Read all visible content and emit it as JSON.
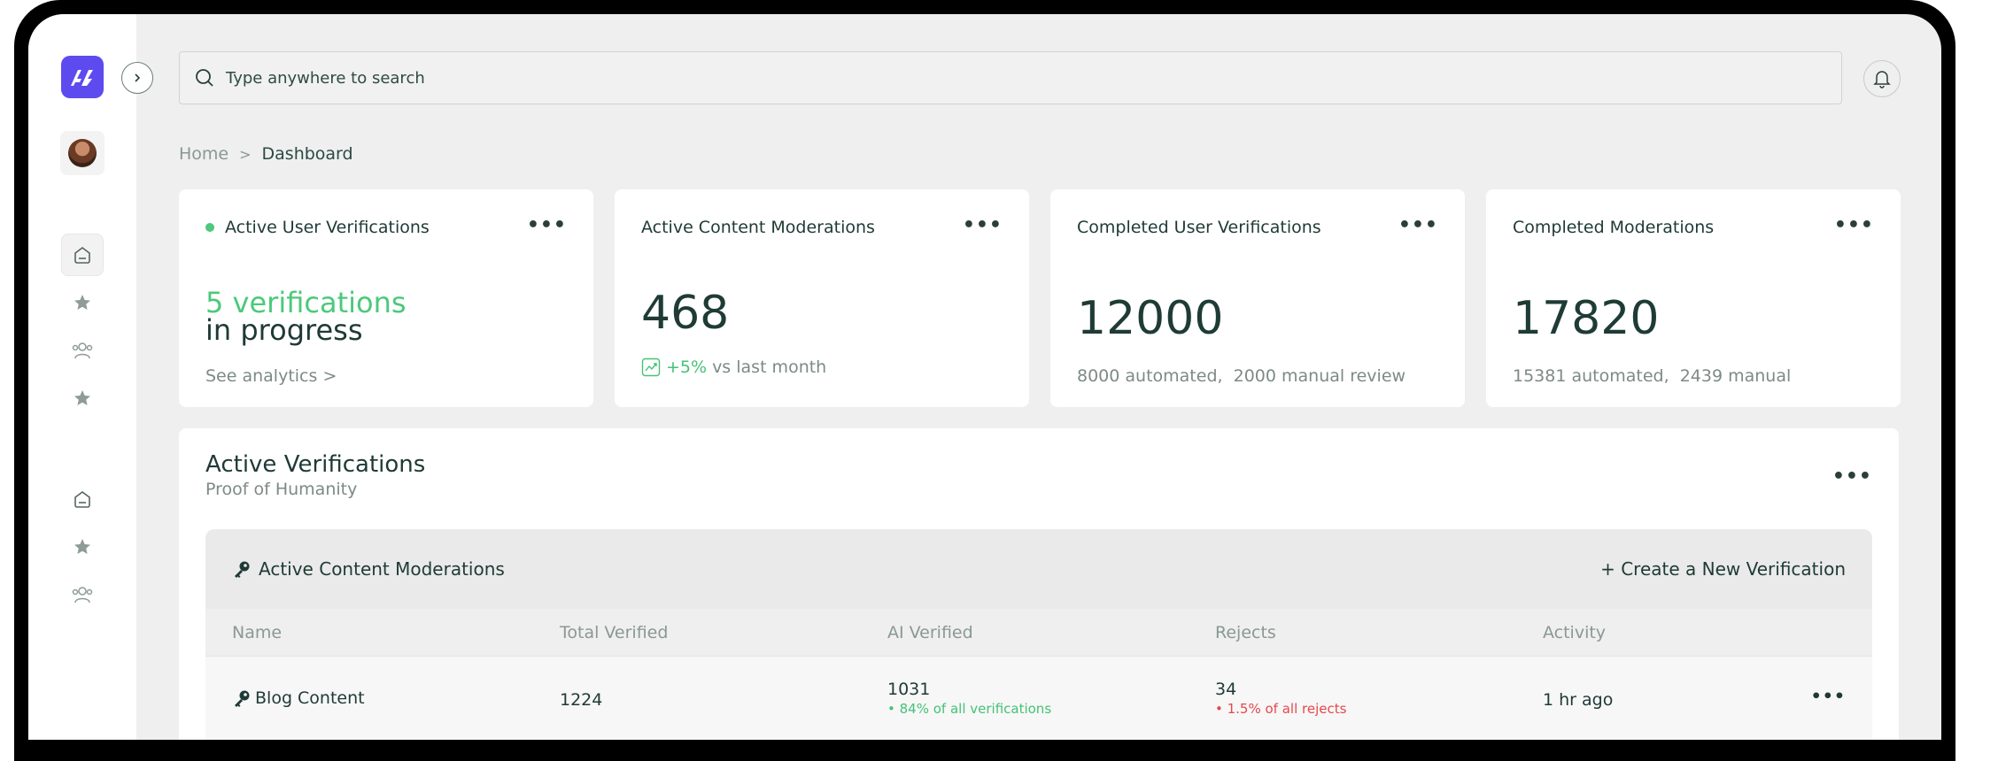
{
  "search": {
    "placeholder": "Type anywhere to search"
  },
  "breadcrumb": {
    "home": "Home",
    "separator": ">",
    "current": "Dashboard"
  },
  "cards": [
    {
      "title": "Active User Verifications",
      "status_dot": "#4cc97b",
      "highlight": "5 verifications",
      "main": "in progress",
      "link": "See analytics >"
    },
    {
      "title": "Active Content Moderations",
      "value": "468",
      "change": "+5%",
      "change_suffix": "vs last month"
    },
    {
      "title": "Completed User Verifications",
      "value": "12000",
      "detail": "8000 automated,  2000 manual review"
    },
    {
      "title": "Completed Moderations",
      "value": "17820",
      "detail": "15381 automated,  2439 manual"
    }
  ],
  "active_panel": {
    "title": "Active Verifications",
    "subtitle": "Proof of Humanity",
    "inner_title": "Active Content Moderations",
    "create_label": "+ Create a New Verification",
    "columns": [
      "Name",
      "Total Verified",
      "AI Verified",
      "Rejects",
      "Activity"
    ],
    "rows": [
      {
        "name": "Blog Content",
        "total": "1224",
        "ai_verified": "1031",
        "ai_note": "84% of all verifications",
        "rejects": "34",
        "rejects_note": "1.5% of all rejects",
        "activity": "1 hr ago"
      }
    ]
  },
  "colors": {
    "accent": "#5d4bef",
    "positive": "#45c276",
    "negative": "#e5484d",
    "text": "#1f3a35",
    "muted": "#7d8a86"
  },
  "icons": [
    "logo-icon",
    "chevron-right-icon",
    "search-icon",
    "bell-icon",
    "home-icon",
    "star-icon",
    "users-icon",
    "more-icon",
    "trend-icon",
    "key-icon"
  ]
}
